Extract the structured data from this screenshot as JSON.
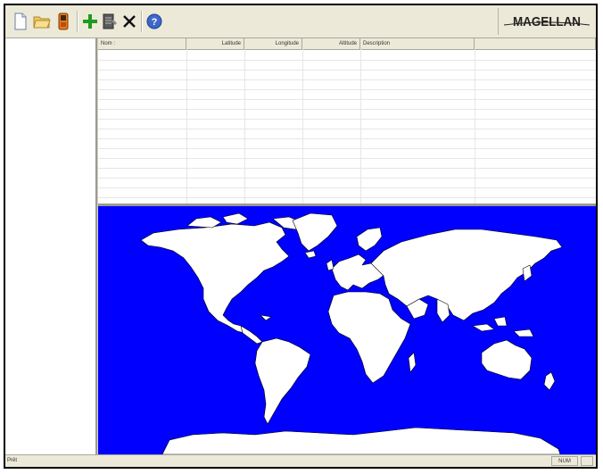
{
  "toolbar": {
    "buttons": [
      {
        "name": "new-file",
        "icon": "blank-page-icon"
      },
      {
        "name": "open-folder",
        "icon": "folder-icon"
      },
      {
        "name": "gps-device",
        "icon": "gps-device-icon"
      },
      {
        "name": "add-waypoint",
        "icon": "plus-icon"
      },
      {
        "name": "edit-waypoint",
        "icon": "notepad-icon"
      },
      {
        "name": "delete-waypoint",
        "icon": "x-icon"
      },
      {
        "name": "help",
        "icon": "help-icon"
      }
    ],
    "logo_text": "MAGELLAN"
  },
  "table": {
    "columns": [
      "Nom :",
      "Latitude",
      "Longitude",
      "Altitude",
      "Description",
      ""
    ]
  },
  "map": {
    "ocean_color": "#0000ff",
    "land_color": "#ffffff"
  },
  "status": {
    "text": "Prêt",
    "num": "NUM"
  }
}
